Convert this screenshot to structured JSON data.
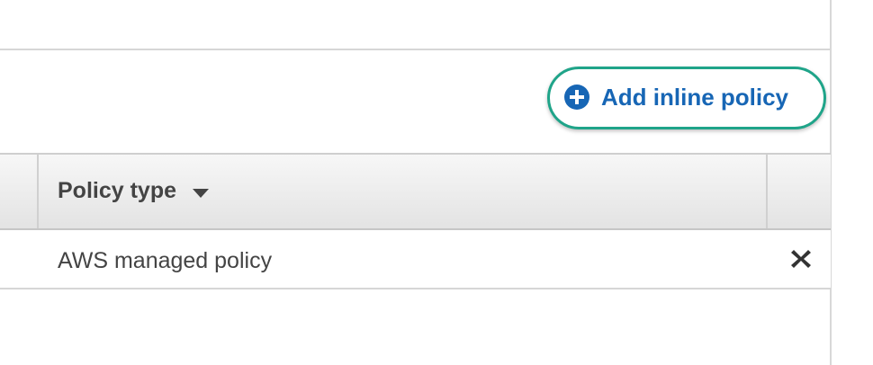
{
  "actions": {
    "add_inline_policy_label": "Add inline policy",
    "add_icon": "plus-circle-icon"
  },
  "table": {
    "columns": [
      "Policy type"
    ],
    "sort_icon": "caret-down-icon",
    "rows": [
      {
        "policy_type": "AWS managed policy",
        "remove_icon": "close-icon"
      }
    ]
  },
  "colors": {
    "link_blue": "#1766b5",
    "highlight_ring": "#1fa489",
    "text_dark": "#444444"
  }
}
